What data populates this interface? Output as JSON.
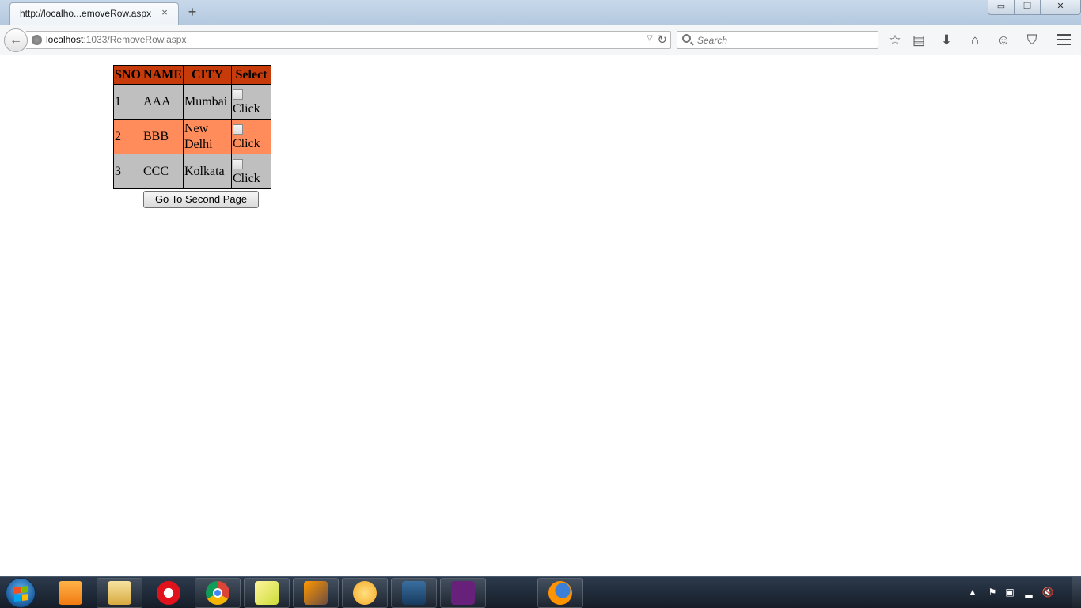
{
  "browser": {
    "tab_title": "http://localho...emoveRow.aspx",
    "tab_close": "×",
    "new_tab": "+",
    "url_host": "localhost",
    "url_rest": ":1033/RemoveRow.aspx",
    "search_placeholder": "Search",
    "window_controls": {
      "minimize": "▭",
      "restore": "❐",
      "close": "✕"
    }
  },
  "table": {
    "headers": [
      "SNO",
      "NAME",
      "CITY",
      "Select"
    ],
    "rows": [
      {
        "sno": "1",
        "name": "AAA",
        "city": "Mumbai",
        "select_label": "Click"
      },
      {
        "sno": "2",
        "name": "BBB",
        "city": "New Delhi",
        "select_label": "Click"
      },
      {
        "sno": "3",
        "name": "CCC",
        "city": "Kolkata",
        "select_label": "Click"
      }
    ],
    "colors": {
      "header": "#c73b0b",
      "row_even": "#bfbfbf",
      "row_odd": "#ff8c5a"
    }
  },
  "page": {
    "go_button_label": "Go To Second Page"
  },
  "taskbar": {
    "apps": [
      "uc-browser-icon",
      "file-explorer-icon",
      "opera-icon",
      "chrome-icon",
      "sticky-notes-icon",
      "ccleaner-icon",
      "messenger-icon",
      "mysql-workbench-icon",
      "visual-studio-icon",
      "firefox-icon"
    ]
  }
}
